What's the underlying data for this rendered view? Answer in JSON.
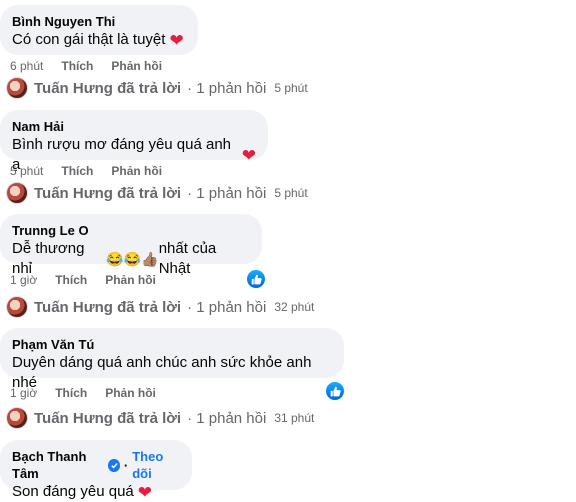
{
  "comments": [
    {
      "author": "Bình Nguyen Thi",
      "text": "Có con gái thật là tuyệt",
      "time": "6 phút"
    },
    {
      "author": "Nam Hải",
      "text": "Bình rượu mơ đáng yêu quá anh ạ",
      "time": "5 phút"
    },
    {
      "author": "Trunng Le O",
      "text_before": "Dễ thương nhỉ",
      "text_after": "nhất của Nhật",
      "emojis": [
        "😂",
        "😂",
        "👍🏽"
      ],
      "time": "1 giờ"
    },
    {
      "author": "Phạm Văn Tú",
      "text": "Duyên dáng quá anh chúc anh sức khỏe anh nhé",
      "time": "1 giờ"
    },
    {
      "author": "Bạch Thanh Tâm",
      "follow": "Theo dõi",
      "text": "Son đáng yêu quá"
    }
  ],
  "actions": {
    "like": "Thích",
    "reply": "Phản hồi"
  },
  "replies": [
    {
      "name": "Tuấn Hưng đã trả lời",
      "count": "· 1 phản hồi",
      "time": "5 phút"
    },
    {
      "name": "Tuấn Hưng đã trả lời",
      "count": "· 1 phản hồi",
      "time": "5 phút"
    },
    {
      "name": "Tuấn Hưng đã trả lời",
      "count": "· 1 phản hồi",
      "time": "32 phút"
    },
    {
      "name": "Tuấn Hưng đã trả lời",
      "count": "· 1 phản hồi",
      "time": "31 phút"
    }
  ],
  "colors": {
    "bubble": "#f0f2f5",
    "muted": "#65676b",
    "link": "#1877f2",
    "heart": "#e41e3f"
  }
}
